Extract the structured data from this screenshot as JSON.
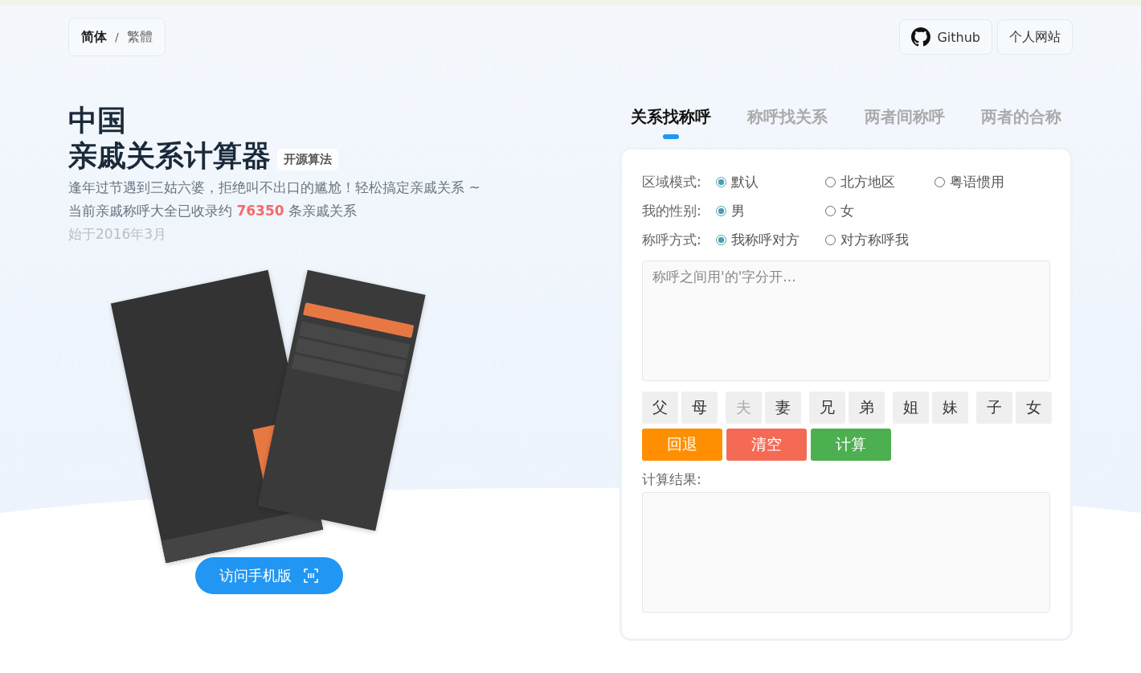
{
  "language_switch": [
    {
      "label": "简体",
      "selected": true
    },
    {
      "label": "繁體",
      "selected": false
    }
  ],
  "language_separator": "/",
  "header_links": [
    {
      "label": "Github",
      "kind": "github"
    },
    {
      "label": "个人网站",
      "kind": "plain"
    }
  ],
  "hero": {
    "title_line_1": "中国",
    "title_line_2": "亲戚关系计算器",
    "badge": "开源算法",
    "tagline": "逢年过节遇到三姑六婆，拒绝叫不出口的尴尬！轻松搞定亲戚关系 ~",
    "count_before": "当前亲戚称呼大全已收录约",
    "count": "76350",
    "count_after": "条亲戚关系",
    "since": "始于2016年3月"
  },
  "mobile_button": {
    "label": "访问手机版"
  },
  "tabs": [
    {
      "label": "关系找称呼",
      "selected": true
    },
    {
      "label": "称呼找关系",
      "selected": false
    },
    {
      "label": "两者间称呼",
      "selected": false
    },
    {
      "label": "两者的合称",
      "selected": false
    }
  ],
  "options": [
    {
      "label": "区域模式:",
      "choices": [
        {
          "label": "默认",
          "selected": true
        },
        {
          "label": "北方地区",
          "selected": false
        },
        {
          "label": "粤语惯用",
          "selected": false
        }
      ]
    },
    {
      "label": "我的性别:",
      "choices": [
        {
          "label": "男",
          "selected": true
        },
        {
          "label": "女",
          "selected": false
        }
      ]
    },
    {
      "label": "称呼方式:",
      "choices": [
        {
          "label": "我称呼对方",
          "selected": true
        },
        {
          "label": "对方称呼我",
          "selected": false
        }
      ]
    }
  ],
  "input": {
    "placeholder": "称呼之间用'的'字分开..."
  },
  "key_groups": [
    [
      {
        "label": "父",
        "disabled": false
      },
      {
        "label": "母",
        "disabled": false
      }
    ],
    [
      {
        "label": "夫",
        "disabled": true
      },
      {
        "label": "妻",
        "disabled": false
      }
    ],
    [
      {
        "label": "兄",
        "disabled": false
      },
      {
        "label": "弟",
        "disabled": false
      }
    ],
    [
      {
        "label": "姐",
        "disabled": false
      },
      {
        "label": "妹",
        "disabled": false
      }
    ],
    [
      {
        "label": "子",
        "disabled": false
      },
      {
        "label": "女",
        "disabled": false
      }
    ]
  ],
  "actions": [
    {
      "label": "回退",
      "kind": "back"
    },
    {
      "label": "清空",
      "kind": "clear"
    },
    {
      "label": "计算",
      "kind": "calc"
    }
  ],
  "result": {
    "label": "计算结果:"
  }
}
